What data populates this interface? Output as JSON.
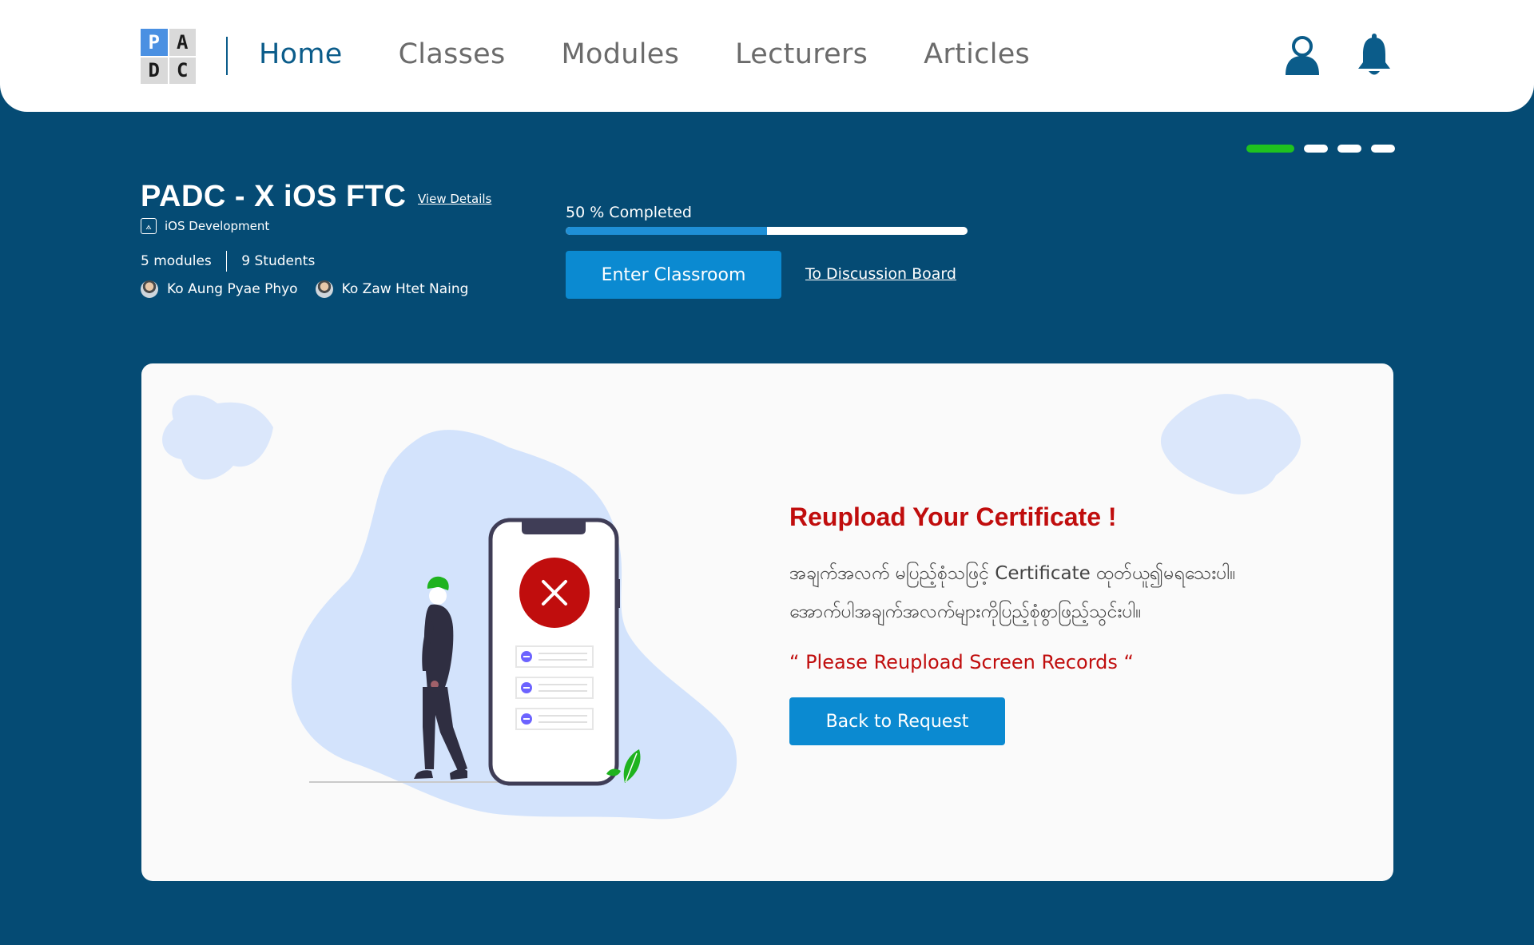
{
  "header": {
    "logo_letters": [
      "P",
      "A",
      "D",
      "C"
    ],
    "nav": [
      {
        "label": "Home",
        "active": true
      },
      {
        "label": "Classes",
        "active": false
      },
      {
        "label": "Modules",
        "active": false
      },
      {
        "label": "Lecturers",
        "active": false
      },
      {
        "label": "Articles",
        "active": false
      }
    ],
    "icons": [
      "user-icon",
      "bell-icon"
    ]
  },
  "carousel": {
    "slides": 4,
    "active_index": 0,
    "active_color": "#1fc21f"
  },
  "course": {
    "title": "PADC - X iOS FTC",
    "view_details": "View Details",
    "category": "iOS Development",
    "modules": "5 modules",
    "students": "9 Students",
    "lecturers": [
      "Ko Aung Pyae Phyo",
      "Ko Zaw Htet Naing"
    ],
    "progress_label": "50 % Completed",
    "progress_fraction": 0.5,
    "enter_button": "Enter Classroom",
    "discussion_link": "To Discussion Board"
  },
  "card": {
    "title": "Reupload Your Certificate !",
    "message_line1": "အချက်အလက် မပြည့်စုံသဖြင့် Certificate ထုတ်ယူ၍မရသေးပါ။",
    "message_line2": "အောက်ပါအချက်အလက်များကိုပြည့်စုံစွာဖြည့်သွင်းပါ။",
    "note": "“ Please Reupload Screen Records “",
    "back_button": "Back to Request"
  },
  "colors": {
    "background": "#054b74",
    "accent_blue": "#0b8ad1",
    "error_red": "#c00d0d",
    "nav_active": "#0b5c8a"
  }
}
